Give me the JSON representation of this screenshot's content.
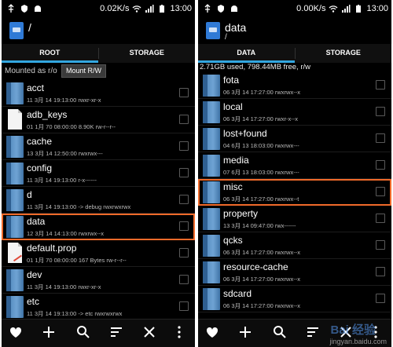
{
  "left": {
    "status": {
      "speed": "0.02K/s",
      "time": "13:00"
    },
    "title": {
      "path": "/",
      "sub": ""
    },
    "tabs": [
      "ROOT",
      "STORAGE"
    ],
    "mount": {
      "text": "Mounted as r/o",
      "button": "Mount R/W"
    },
    "rows": [
      {
        "name": "acct",
        "meta": "11 3月 14 19:13:00   rwxr-xr-x",
        "type": "folder",
        "highlight": false
      },
      {
        "name": "adb_keys",
        "meta": "01 1月 70 08:00:00  8.90K  rw-r--r--",
        "type": "file",
        "highlight": false
      },
      {
        "name": "cache",
        "meta": "13 3月 14 12:50:00   rwxrwx---",
        "type": "folder",
        "highlight": false
      },
      {
        "name": "config",
        "meta": "11 3月 14 19:13:00   r-x------",
        "type": "folder",
        "highlight": false
      },
      {
        "name": "d",
        "meta": "11 3月 14 19:13:00  -> debug  rwxrwxrwx",
        "type": "folder",
        "highlight": false
      },
      {
        "name": "data",
        "meta": "12 3月 14 14:13:00   rwxrwx--x",
        "type": "folder",
        "highlight": true
      },
      {
        "name": "default.prop",
        "meta": "01 1月 70 08:00:00  167 Bytes  rw-r--r--",
        "type": "prop",
        "highlight": false
      },
      {
        "name": "dev",
        "meta": "11 3月 14 19:13:00   rwxr-xr-x",
        "type": "folder",
        "highlight": false
      },
      {
        "name": "etc",
        "meta": "11 3月 14 19:13:00  -> etc  rwxrwxrwx",
        "type": "folder",
        "highlight": false
      }
    ]
  },
  "right": {
    "status": {
      "speed": "0.00K/s",
      "time": "13:00"
    },
    "title": {
      "path": "data",
      "sub": "/"
    },
    "tabs": [
      "DATA",
      "STORAGE"
    ],
    "info": "2.71GB used, 798.44MB free, r/w",
    "rows": [
      {
        "name": "fota",
        "meta": "06 3月 14 17:27:00   rwxrwx--x",
        "type": "folder",
        "highlight": false
      },
      {
        "name": "local",
        "meta": "06 3月 14 17:27:00   rwxr-x--x",
        "type": "folder",
        "highlight": false
      },
      {
        "name": "lost+found",
        "meta": "04 6月 13 18:03:00   rwxrwx---",
        "type": "folder",
        "highlight": false
      },
      {
        "name": "media",
        "meta": "07 6月 13 18:03:00   rwxrwx---",
        "type": "folder",
        "highlight": false
      },
      {
        "name": "misc",
        "meta": "06 3月 14 17:27:00   rwxrwx--t",
        "type": "folder",
        "highlight": true
      },
      {
        "name": "property",
        "meta": "13 3月 14 09:47:00   rwx------",
        "type": "folder",
        "highlight": false
      },
      {
        "name": "qcks",
        "meta": "06 3月 14 17:27:00   rwxrwx--x",
        "type": "folder",
        "highlight": false
      },
      {
        "name": "resource-cache",
        "meta": "06 3月 14 17:27:00   rwxrwx--x",
        "type": "folder",
        "highlight": false
      },
      {
        "name": "sdcard",
        "meta": "06 3月 14 17:27:00   rwxrwx--x",
        "type": "folder",
        "highlight": false
      }
    ]
  },
  "bottombar": {
    "icons": [
      "heart-icon",
      "plus-icon",
      "search-icon",
      "sort-icon",
      "close-icon",
      "more-icon"
    ]
  },
  "watermark": {
    "logo": "Bai 经验",
    "url": "jingyan.baidu.com"
  },
  "colors": {
    "accent": "#33a7e0",
    "highlight": "#f06a2a",
    "folder": "#4a82b8"
  }
}
